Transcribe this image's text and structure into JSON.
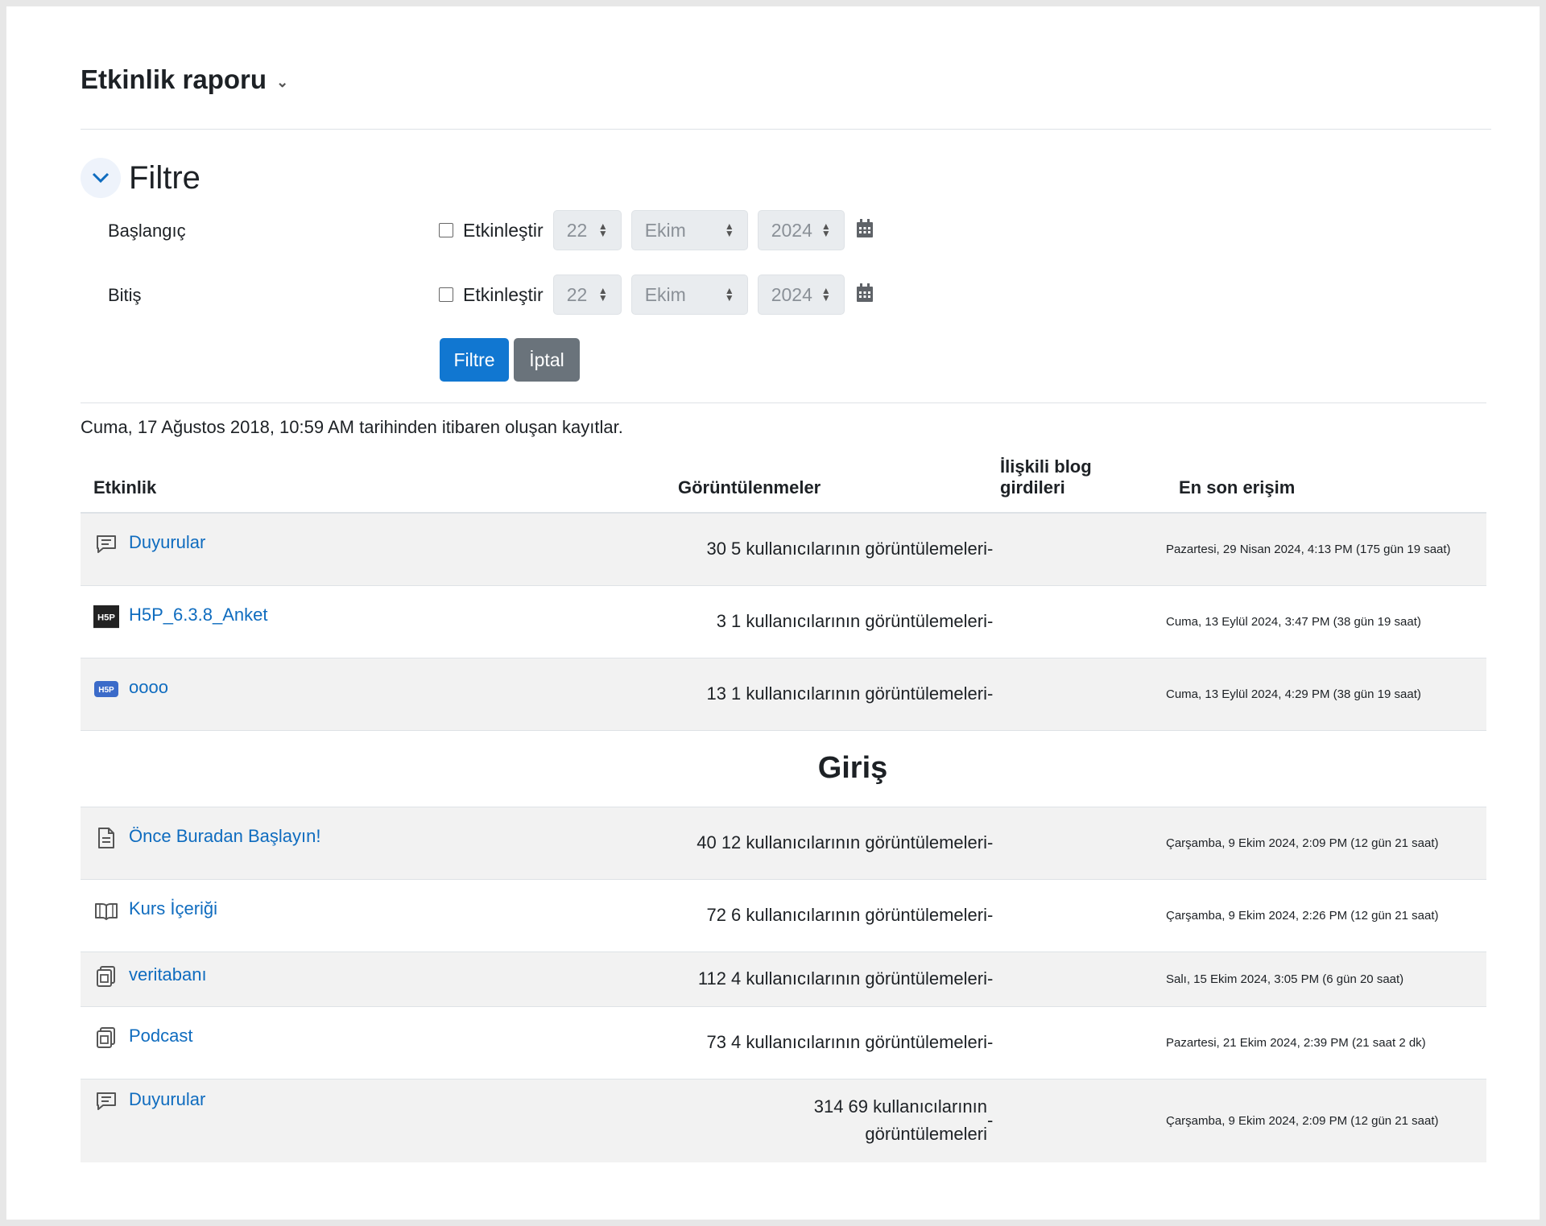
{
  "header": {
    "title": "Etkinlik raporu"
  },
  "filter": {
    "title": "Filtre",
    "start_label": "Başlangıç",
    "end_label": "Bitiş",
    "enable_label": "Etkinleştir",
    "start": {
      "day": "22",
      "month": "Ekim",
      "year": "2024"
    },
    "end": {
      "day": "22",
      "month": "Ekim",
      "year": "2024"
    },
    "filter_button": "Filtre",
    "cancel_button": "İptal"
  },
  "since_text": "Cuma, 17 Ağustos 2018, 10:59 AM tarihinden itibaren oluşan kayıtlar.",
  "table": {
    "headers": {
      "activity": "Etkinlik",
      "views": "Görüntülenmeler",
      "blog_line1": "İlişkili blog",
      "blog_line2": "girdileri",
      "last_access": "En son erişim"
    },
    "rows": [
      {
        "icon": "forum-icon",
        "name": "Duyurular",
        "views": "30 5 kullanıcılarının görüntülemeleri",
        "blog": "-",
        "last": "Pazartesi, 29 Nisan 2024, 4:13 PM (175 gün 19 saat)"
      },
      {
        "icon": "h5p-dark-icon",
        "name": "H5P_6.3.8_Anket",
        "views": "3 1 kullanıcılarının görüntülemeleri",
        "blog": "-",
        "last": "Cuma, 13 Eylül 2024, 3:47 PM (38 gün 19 saat)"
      },
      {
        "icon": "h5p-blue-icon",
        "name": "oooo",
        "views": "13 1 kullanıcılarının görüntülemeleri",
        "blog": "-",
        "last": "Cuma, 13 Eylül 2024, 4:29 PM (38 gün 19 saat)"
      }
    ],
    "section_title": "Giriş",
    "section_rows": [
      {
        "icon": "page-icon",
        "name": "Önce Buradan Başlayın!",
        "views": "40 12 kullanıcılarının görüntülemeleri",
        "blog": "-",
        "last": "Çarşamba, 9 Ekim 2024, 2:09 PM (12 gün 21 saat)"
      },
      {
        "icon": "book-icon",
        "name": "Kurs İçeriği",
        "views": "72 6 kullanıcılarının görüntülemeleri",
        "blog": "-",
        "last": "Çarşamba, 9 Ekim 2024, 2:26 PM (12 gün 21 saat)"
      },
      {
        "icon": "resource-icon",
        "name": "veritabanı",
        "views": "112 4 kullanıcılarının görüntülemeleri",
        "blog": "-",
        "last": "Salı, 15 Ekim 2024, 3:05 PM (6 gün 20 saat)"
      },
      {
        "icon": "resource-icon",
        "name": "Podcast",
        "views": "73 4 kullanıcılarının görüntülemeleri",
        "blog": "-",
        "last": "Pazartesi, 21 Ekim 2024, 2:39 PM (21 saat 2 dk)"
      },
      {
        "icon": "forum-icon",
        "name": "Duyurular",
        "views_line1": "314 69 kullanıcılarının",
        "views_line2": "görüntülemeleri",
        "blog": "-",
        "last": "Çarşamba, 9 Ekim 2024, 2:09 PM (12 gün 21 saat)"
      }
    ]
  }
}
